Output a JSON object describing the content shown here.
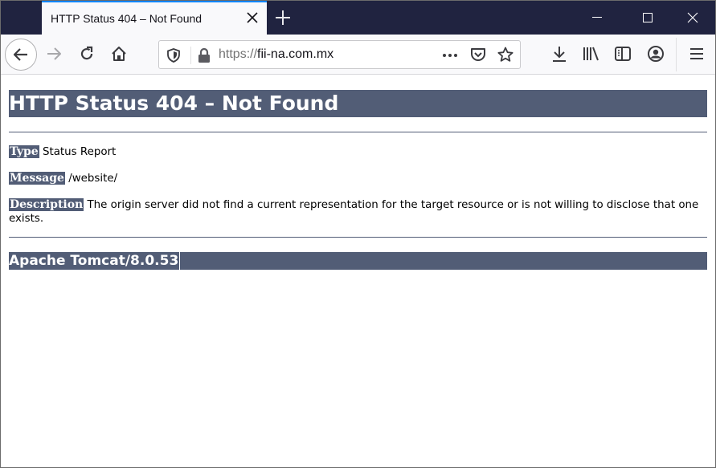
{
  "browser": {
    "tab": {
      "title": "HTTP Status 404 – Not Found",
      "close_icon": "close-icon"
    },
    "new_tab_icon": "plus-icon",
    "window_controls": {
      "minimize": "minimize-icon",
      "maximize": "maximize-icon",
      "close": "close-icon"
    },
    "nav": {
      "back": "arrow-left-icon",
      "forward": "arrow-right-icon",
      "reload": "reload-icon",
      "home": "home-icon"
    },
    "urlbar": {
      "scheme": "https://",
      "host": "fii-na.com.mx",
      "tracking_icon": "shield-icon",
      "lock_icon": "lock-icon",
      "page_actions_icon": "more-horizontal-icon",
      "pocket_icon": "pocket-icon",
      "bookmark_icon": "star-icon"
    },
    "toolbar": {
      "downloads": "download-icon",
      "library": "library-icon",
      "sidebar": "sidebar-icon",
      "account": "account-icon",
      "menu": "hamburger-menu-icon"
    }
  },
  "page": {
    "heading": "HTTP Status 404 – Not Found",
    "type_label": "Type",
    "type_value": " Status Report",
    "message_label": "Message",
    "message_value": " /website/",
    "description_label": "Description",
    "description_value": " The origin server did not find a current representation for the target resource or is not willing to disclose that one exists.",
    "footer": "Apache Tomcat/8.0.53"
  },
  "colors": {
    "tomcat_accent": "#525d76",
    "titlebar": "#202340",
    "active_tab_highlight": "#0a84ff"
  }
}
